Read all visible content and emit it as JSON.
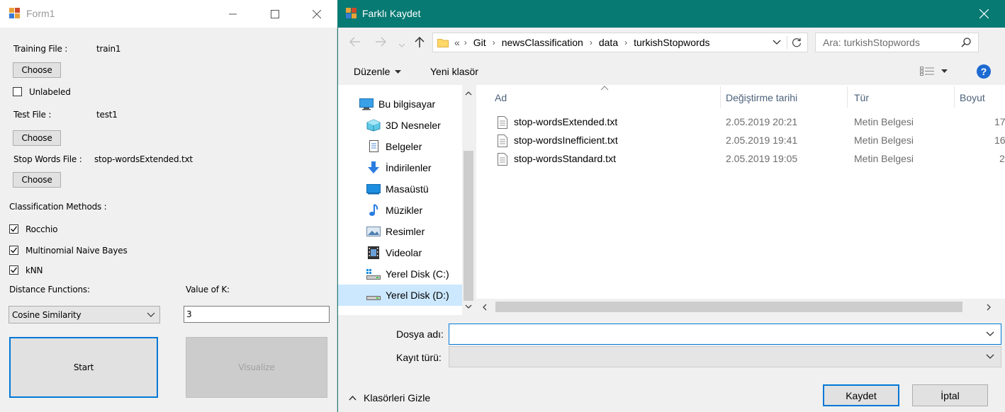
{
  "form1": {
    "title": "Form1",
    "training_label": "Training File :",
    "training_value": "train1",
    "choose_label": "Choose",
    "unlabeled_label": "Unlabeled",
    "unlabeled_checked": false,
    "test_label": "Test File :",
    "test_value": "test1",
    "stopwords_label": "Stop Words File :",
    "stopwords_value": "stop-wordsExtended.txt",
    "methods_label": "Classification Methods :",
    "methods": [
      {
        "label": "Rocchio",
        "checked": true
      },
      {
        "label": "Multinomial Naive Bayes",
        "checked": true
      },
      {
        "label": "kNN",
        "checked": true
      }
    ],
    "distance_label": "Distance Functions:",
    "distance_value": "Cosine Similarity",
    "k_label": "Value of K:",
    "k_value": "3",
    "start_label": "Start",
    "visualize_label": "Visualize"
  },
  "dialog": {
    "title": "Farklı Kaydet",
    "breadcrumb_prefix": "«",
    "breadcrumb": [
      "Git",
      "newsClassification",
      "data",
      "turkishStopwords"
    ],
    "search_placeholder": "Ara: turkishStopwords",
    "organize_label": "Düzenle",
    "new_folder_label": "Yeni klasör",
    "help_label": "?",
    "nav": [
      {
        "label": "Bu bilgisayar",
        "icon": "computer-icon"
      },
      {
        "label": "3D Nesneler",
        "icon": "3d-objects-icon"
      },
      {
        "label": "Belgeler",
        "icon": "documents-icon"
      },
      {
        "label": "İndirilenler",
        "icon": "downloads-icon"
      },
      {
        "label": "Masaüstü",
        "icon": "desktop-icon"
      },
      {
        "label": "Müzikler",
        "icon": "music-icon"
      },
      {
        "label": "Resimler",
        "icon": "pictures-icon"
      },
      {
        "label": "Videolar",
        "icon": "videos-icon"
      },
      {
        "label": "Yerel Disk (C:)",
        "icon": "drive-c-icon"
      },
      {
        "label": "Yerel Disk (D:)",
        "icon": "drive-d-icon",
        "selected": true
      }
    ],
    "columns": {
      "name": "Ad",
      "modified": "Değiştirme tarihi",
      "type": "Tür",
      "size": "Boyut"
    },
    "files": [
      {
        "name": "stop-wordsExtended.txt",
        "modified": "2.05.2019 20:21",
        "type": "Metin Belgesi",
        "size": "17"
      },
      {
        "name": "stop-wordsInefficient.txt",
        "modified": "2.05.2019 19:41",
        "type": "Metin Belgesi",
        "size": "16"
      },
      {
        "name": "stop-wordsStandard.txt",
        "modified": "2.05.2019 19:05",
        "type": "Metin Belgesi",
        "size": "2"
      }
    ],
    "filename_label": "Dosya adı:",
    "filename_value": "",
    "filetype_label": "Kayıt türü:",
    "filetype_value": "",
    "hide_folders_label": "Klasörleri Gizle",
    "save_label": "Kaydet",
    "cancel_label": "İptal",
    "accent_color": "#067a73"
  }
}
